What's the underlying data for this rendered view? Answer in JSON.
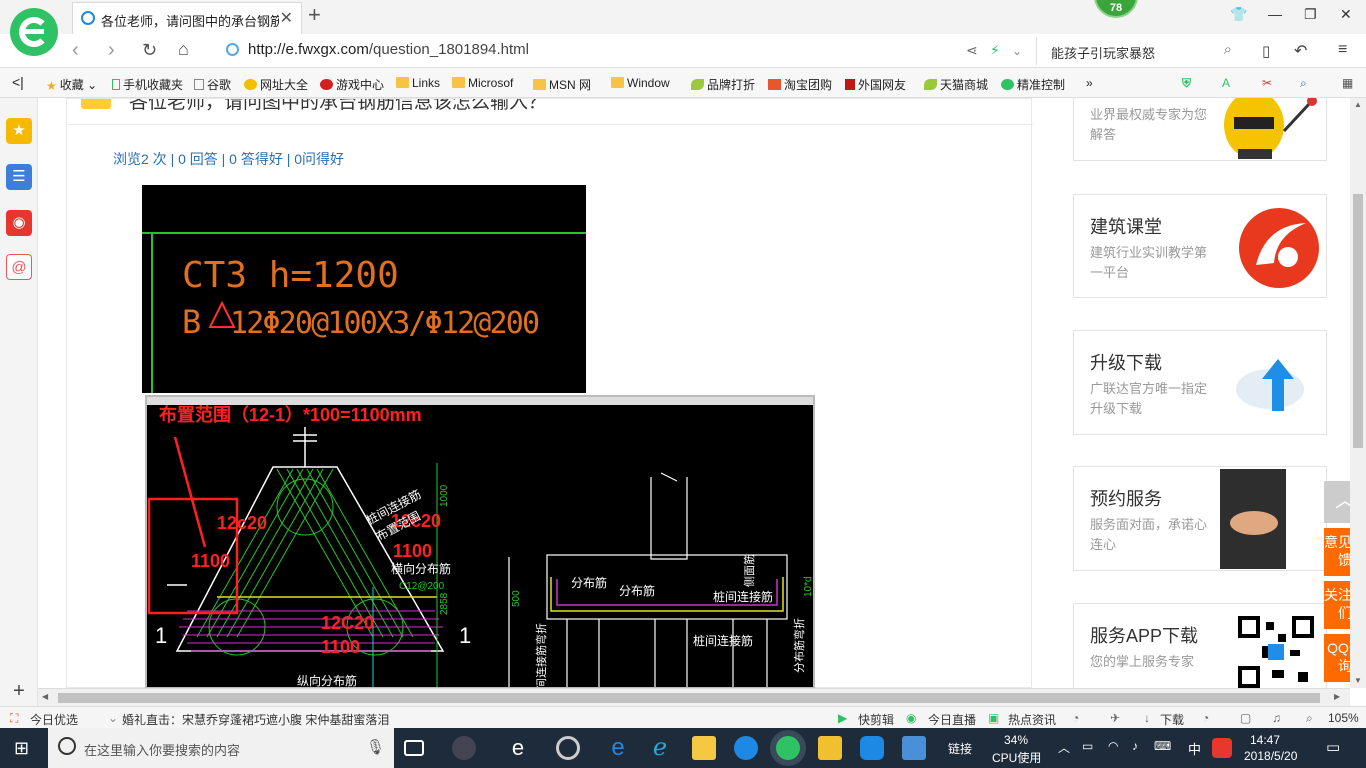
{
  "browser": {
    "tab_title": "各位老师，请问图中的承台钢筋信",
    "badge": "78",
    "url_domain": "http://e.fwxgx.com",
    "url_path": "/question_1801894.html",
    "search_text": "能孩子引玩家暴怒",
    "icons": [
      "back-icon",
      "forward-icon",
      "reload-icon",
      "home-icon",
      "share-icon",
      "lightning-icon",
      "search-icon",
      "mobile-icon",
      "undo-icon",
      "menu-icon"
    ]
  },
  "bookmarks": {
    "items": [
      "收藏",
      "手机收藏夹",
      "谷歌",
      "网址大全",
      "游戏中心",
      "Links",
      "Microsof",
      "MSN 网",
      "Window",
      "品牌打折",
      "淘宝团购",
      "外国网友",
      "天猫商城",
      "精准控制"
    ],
    "more": "»"
  },
  "question": {
    "title_cut": "各位老师，请问图中的承台钢筋信息该怎么输入？",
    "stats": "浏览2 次 | 0 回答 | 0 答得好 | 0问得好"
  },
  "cad1": {
    "line1": "CT3 h=1200",
    "line2": "B",
    "line2b": "12Φ20@100X3/Φ12@200"
  },
  "cad2": {
    "header_label": "布置范围（12-1）*100=1100mm",
    "lbl_a": "12c20",
    "lbl_b": "1100",
    "lbl_c": "12c20",
    "lbl_d": "1100",
    "lbl_e": "12C20",
    "lbl_f": "1100",
    "lbl_zhuangjian": "桩间连接筋",
    "lbl_buzhi": "布置范围",
    "lbl_hengxiang": "横向分布筋",
    "lbl_c12": "C12@200",
    "lbl_one_left": "1",
    "lbl_one_right": "1",
    "lbl_zongxiang": "纵向分布筋",
    "lbl_dim_1000": "1000",
    "lbl_dim_2858": "2858",
    "lbl_dim_500": "500",
    "lbl_fenbu1": "分布筋",
    "lbl_fenbu2": "分布筋",
    "lbl_zhuangjian2": "桩间连接筋",
    "lbl_zhuangjian3": "桩间连接筋",
    "lbl_cemian": "侧面筋",
    "lbl_fenbu_wanzhe": "分布筋弯折",
    "lbl_10d": "10*d",
    "lbl_lianjie_wanzhe": "间连接筋弯折"
  },
  "sidebar_cards": [
    {
      "title": "",
      "desc": "业界最权威专家为您解答"
    },
    {
      "title": "建筑课堂",
      "desc": "建筑行业实训教学第一平台"
    },
    {
      "title": "升级下载",
      "desc": "广联达官方唯一指定升级下载"
    },
    {
      "title": "预约服务",
      "desc": "服务面对面，承诺心连心"
    },
    {
      "title": "服务APP下载",
      "desc": "您的掌上服务专家"
    }
  ],
  "float_buttons": [
    "意见反馈",
    "关注我们",
    "QQ咨询"
  ],
  "statusbar": {
    "left": "今日优选",
    "news": "婚礼直击：宋慧乔穿蓬裙巧遮小腹 宋仲基甜蜜落泪",
    "r1": "快剪辑",
    "r2": "今日直播",
    "r3": "热点资讯",
    "r4": "下载",
    "zoom": "105%"
  },
  "taskbar": {
    "search_placeholder": "在这里输入你要搜索的内容",
    "link": "链接",
    "cpu_pct": "34%",
    "cpu_label": "CPU使用",
    "ime": "中",
    "time": "14:47",
    "date": "2018/5/20"
  },
  "colors": {
    "accent_green": "#2ec265",
    "link_blue": "#2a6fb5",
    "float_orange": "#ff6a00",
    "cad_orange": "#e07020",
    "cad_red": "#ff2020"
  }
}
